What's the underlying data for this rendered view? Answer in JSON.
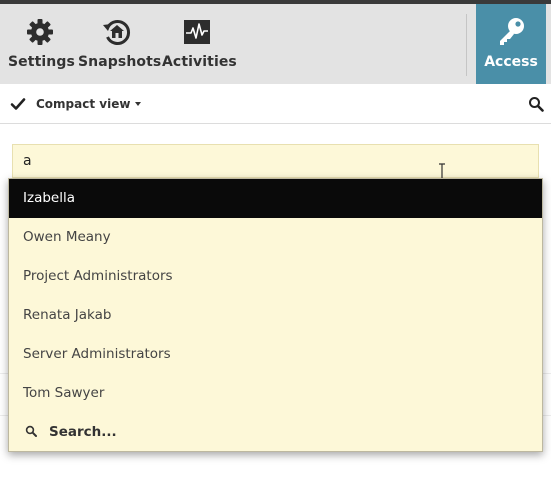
{
  "toolbar": {
    "settings_label": "Settings",
    "snapshots_label": "Snapshots",
    "activities_label": "Activities",
    "access_label": "Access",
    "accent_color": "#4a8fa8"
  },
  "viewbar": {
    "view_mode": "Compact view"
  },
  "search": {
    "value": "a"
  },
  "autocomplete": {
    "items": [
      {
        "label": "Izabella",
        "selected": true
      },
      {
        "label": "Owen Meany",
        "selected": false
      },
      {
        "label": "Project Administrators",
        "selected": false
      },
      {
        "label": "Renata Jakab",
        "selected": false
      },
      {
        "label": "Server Administrators",
        "selected": false
      },
      {
        "label": "Tom Sawyer",
        "selected": false
      }
    ],
    "search_more_label": "Search..."
  },
  "icons": [
    "gear-icon",
    "snapshot-restore-icon",
    "activity-pulse-icon",
    "key-icon",
    "check-icon",
    "caret-down-icon",
    "search-icon",
    "text-cursor-icon"
  ]
}
